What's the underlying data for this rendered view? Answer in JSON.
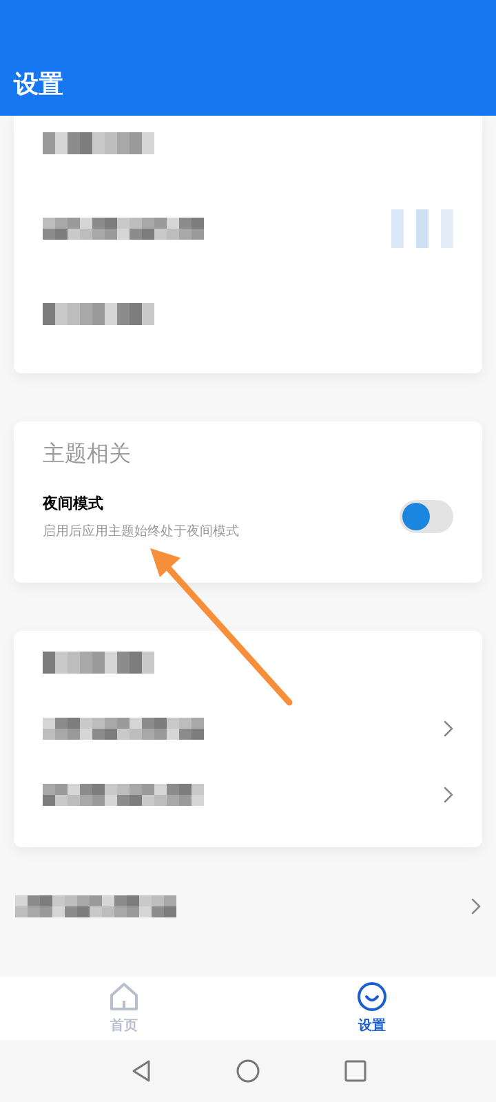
{
  "header": {
    "title": "设置"
  },
  "cards": [
    {
      "kind": "obscured",
      "rows": [
        {
          "kind": "blurred"
        },
        {
          "kind": "blurred_toggle_area"
        },
        {
          "kind": "blurred"
        }
      ]
    },
    {
      "kind": "settings",
      "heading": "主题相关",
      "rows": [
        {
          "kind": "toggle",
          "title": "夜间模式",
          "subtitle": "启用后应用主题始终处于夜间模式",
          "on": false
        }
      ]
    },
    {
      "kind": "obscured",
      "rows": [
        {
          "kind": "blurred"
        },
        {
          "kind": "blurred_chevron"
        },
        {
          "kind": "blurred_chevron"
        }
      ]
    },
    {
      "kind": "plain",
      "rows": [
        {
          "kind": "blurred_chevron"
        }
      ]
    }
  ],
  "annotation": {
    "kind": "arrow"
  },
  "bottom_nav": [
    {
      "label": "首页",
      "kind": "home",
      "selected": false
    },
    {
      "label": "设置",
      "kind": "smile",
      "selected": true
    }
  ]
}
